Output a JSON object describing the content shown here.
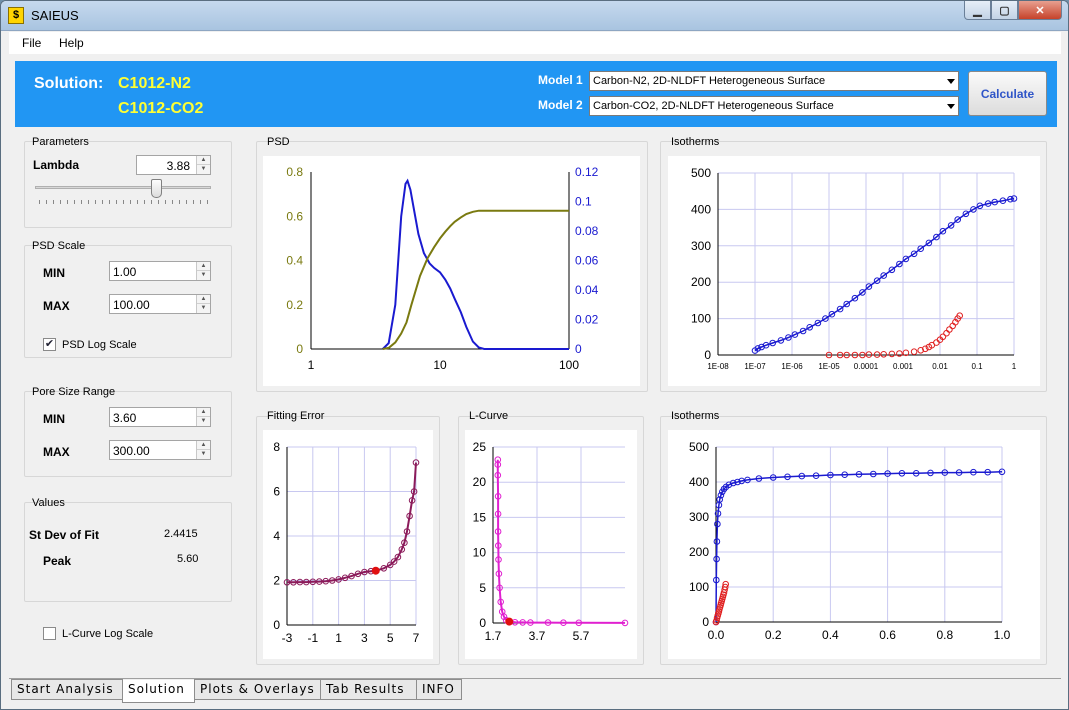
{
  "window": {
    "title": "SAIEUS",
    "icon": "s-logo-icon"
  },
  "menu": [
    "File",
    "Help"
  ],
  "header": {
    "solution_label": "Solution:",
    "solution_names": [
      "C1012-N2",
      "C1012-CO2"
    ],
    "model1_label": "Model 1",
    "model2_label": "Model 2",
    "model1_value": "Carbon-N2, 2D-NLDFT Heterogeneous Surface",
    "model2_value": "Carbon-CO2, 2D-NLDFT Heterogeneous Surface",
    "calculate_label": "Calculate"
  },
  "parameters": {
    "title": "Parameters",
    "lambda_label": "Lambda",
    "lambda_value": "3.88",
    "lambda_slider_fraction": 0.7
  },
  "psd_scale": {
    "title": "PSD Scale",
    "min_label": "MIN",
    "min_value": "1.00",
    "max_label": "MAX",
    "max_value": "100.00",
    "log_label": "PSD Log Scale",
    "log_checked": true
  },
  "pore_range": {
    "title": "Pore Size Range",
    "min_label": "MIN",
    "min_value": "3.60",
    "max_label": "MAX",
    "max_value": "300.00"
  },
  "values": {
    "title": "Values",
    "stdev_label": "St Dev of Fit",
    "stdev_value": "2.4415",
    "peak_label": "Peak",
    "peak_value": "5.60"
  },
  "lcurve_log": {
    "label": "L-Curve Log Scale",
    "checked": false
  },
  "panels": {
    "psd": "PSD",
    "isotherms_top": "Isotherms",
    "fitting_error": "Fitting Error",
    "lcurve": "L-Curve",
    "isotherms_bottom": "Isotherms"
  },
  "tabs": [
    "Start Analysis",
    "Solution",
    "Plots & Overlays",
    "Tab Results",
    "INFO"
  ],
  "active_tab": 1,
  "colors": {
    "header_bg": "#2196f3",
    "solution_name": "#ffff33",
    "n2_series": "#1a1ad0",
    "co2_series": "#e02020",
    "cumulative": "#7a7a10",
    "fitting": "#8b1a5a",
    "lcurve": "#e020d0"
  },
  "chart_data": [
    {
      "id": "psd",
      "type": "line",
      "title": "PSD",
      "x_scale": "log",
      "xlim": [
        1,
        100
      ],
      "x_ticks": [
        "1",
        "10",
        "100"
      ],
      "ylim_left": [
        0,
        0.8
      ],
      "y_ticks_left": [
        "0",
        "0.2",
        "0.4",
        "0.6",
        "0.8"
      ],
      "ylim_right": [
        0,
        0.12
      ],
      "y_ticks_right": [
        "0",
        "0.02",
        "0.04",
        "0.06",
        "0.08",
        "0.1",
        "0.12"
      ],
      "series": [
        {
          "axis": "right",
          "color": "#1a1ad0",
          "x": [
            3.6,
            4.0,
            4.5,
            5.0,
            5.4,
            5.6,
            5.9,
            6.3,
            6.8,
            7.5,
            8.3,
            9.0,
            10.0,
            11.0,
            12.0,
            13.0,
            14.5,
            16.0,
            18.0,
            20.0,
            22.0,
            30,
            50,
            100
          ],
          "y": [
            0,
            0.004,
            0.03,
            0.09,
            0.112,
            0.114,
            0.108,
            0.094,
            0.078,
            0.065,
            0.058,
            0.055,
            0.052,
            0.047,
            0.041,
            0.034,
            0.025,
            0.015,
            0.005,
            0.001,
            0,
            0,
            0,
            0
          ]
        },
        {
          "axis": "left",
          "color": "#7a7a10",
          "x": [
            3.6,
            4.0,
            4.5,
            5.0,
            5.5,
            6.0,
            7.0,
            8.0,
            9.0,
            10.0,
            11.0,
            12.0,
            13.0,
            14.5,
            16.0,
            18.0,
            20.0,
            22.0,
            30,
            50,
            100
          ],
          "y": [
            0,
            0.005,
            0.03,
            0.07,
            0.12,
            0.2,
            0.33,
            0.41,
            0.46,
            0.5,
            0.53,
            0.555,
            0.575,
            0.595,
            0.61,
            0.62,
            0.625,
            0.625,
            0.625,
            0.625,
            0.625
          ]
        }
      ]
    },
    {
      "id": "isotherms_log",
      "type": "scatter",
      "title": "Isotherms",
      "x_scale": "log",
      "xlim": [
        1e-08,
        1
      ],
      "x_ticks": [
        "1E-08",
        "1E-07",
        "1E-06",
        "1E-05",
        "0.0001",
        "0.001",
        "0.01",
        "0.1",
        "1"
      ],
      "ylim": [
        0,
        500
      ],
      "y_ticks": [
        "0",
        "100",
        "200",
        "300",
        "400",
        "500"
      ],
      "series": [
        {
          "color": "#1a1ad0",
          "fit": true,
          "x": [
            1e-07,
            1.2e-07,
            1.5e-07,
            2e-07,
            3e-07,
            5e-07,
            8e-07,
            1.2e-06,
            2e-06,
            3e-06,
            5e-06,
            8e-06,
            1.2e-05,
            2e-05,
            3e-05,
            5e-05,
            8e-05,
            0.00012,
            0.0002,
            0.0003,
            0.0005,
            0.0008,
            0.0012,
            0.002,
            0.003,
            0.005,
            0.008,
            0.012,
            0.02,
            0.03,
            0.05,
            0.08,
            0.12,
            0.2,
            0.3,
            0.5,
            0.8,
            1.0
          ],
          "y": [
            12,
            18,
            22,
            27,
            33,
            40,
            48,
            56,
            66,
            76,
            88,
            100,
            112,
            126,
            140,
            156,
            172,
            188,
            204,
            218,
            234,
            250,
            264,
            278,
            292,
            308,
            324,
            340,
            356,
            372,
            388,
            400,
            410,
            416,
            420,
            424,
            428,
            430
          ]
        },
        {
          "color": "#e02020",
          "fit": false,
          "x": [
            1e-05,
            2e-05,
            3e-05,
            5e-05,
            8e-05,
            0.00012,
            0.0002,
            0.0003,
            0.0005,
            0.0008,
            0.0012,
            0.002,
            0.003,
            0.004,
            0.005,
            0.006,
            0.008,
            0.01,
            0.012,
            0.015,
            0.018,
            0.022,
            0.026,
            0.03,
            0.034
          ],
          "y": [
            0,
            0,
            0,
            0,
            0,
            1,
            1,
            2,
            3,
            4,
            6,
            9,
            13,
            17,
            22,
            27,
            34,
            42,
            50,
            60,
            70,
            80,
            90,
            100,
            108
          ]
        }
      ]
    },
    {
      "id": "fitting_error",
      "type": "line",
      "title": "Fitting Error",
      "xlim": [
        -3,
        7
      ],
      "x_ticks": [
        "-3",
        "-1",
        "1",
        "3",
        "5",
        "7"
      ],
      "ylim": [
        0,
        8
      ],
      "y_ticks": [
        "0",
        "2",
        "4",
        "6",
        "8"
      ],
      "selected_x": 3.88,
      "series": [
        {
          "color": "#8b1a5a",
          "x": [
            -3,
            -2.5,
            -2,
            -1.5,
            -1,
            -0.5,
            0,
            0.5,
            1,
            1.5,
            2,
            2.5,
            3,
            3.5,
            3.88,
            4.5,
            5,
            5.3,
            5.6,
            5.9,
            6.1,
            6.3,
            6.5,
            6.7,
            6.85,
            7
          ],
          "y": [
            1.92,
            1.92,
            1.93,
            1.93,
            1.94,
            1.95,
            1.97,
            2.0,
            2.05,
            2.12,
            2.2,
            2.3,
            2.38,
            2.42,
            2.44,
            2.55,
            2.7,
            2.85,
            3.05,
            3.4,
            3.7,
            4.2,
            4.9,
            5.6,
            6.0,
            7.3
          ]
        }
      ]
    },
    {
      "id": "lcurve",
      "type": "line",
      "title": "L-Curve",
      "xlim": [
        1.7,
        7.7
      ],
      "x_ticks": [
        "1.7",
        "3.7",
        "5.7"
      ],
      "ylim": [
        0,
        25
      ],
      "y_ticks": [
        "0",
        "5",
        "10",
        "15",
        "20",
        "25"
      ],
      "selected_x": 2.44,
      "series": [
        {
          "color": "#e020d0",
          "x": [
            1.92,
            1.92,
            1.92,
            1.93,
            1.93,
            1.93,
            1.94,
            1.95,
            1.97,
            2.0,
            2.05,
            2.12,
            2.2,
            2.3,
            2.44,
            2.7,
            3.05,
            3.4,
            4.2,
            4.9,
            5.6,
            7.7
          ],
          "y": [
            23.2,
            22.5,
            21.0,
            18.0,
            15.5,
            13.0,
            11.0,
            9.0,
            7.0,
            5.0,
            3.0,
            1.6,
            0.9,
            0.4,
            0.2,
            0.1,
            0.08,
            0.06,
            0.05,
            0.04,
            0.03,
            0.02
          ]
        }
      ]
    },
    {
      "id": "isotherms_linear",
      "type": "scatter",
      "title": "Isotherms",
      "xlim": [
        0,
        1
      ],
      "x_ticks": [
        "0.0",
        "0.2",
        "0.4",
        "0.6",
        "0.8",
        "1.0"
      ],
      "ylim": [
        0,
        500
      ],
      "y_ticks": [
        "0",
        "100",
        "200",
        "300",
        "400",
        "500"
      ],
      "series": [
        {
          "color": "#1a1ad0",
          "fit": true,
          "x": [
            0,
            0.001,
            0.002,
            0.003,
            0.005,
            0.007,
            0.01,
            0.013,
            0.017,
            0.022,
            0.028,
            0.035,
            0.045,
            0.06,
            0.075,
            0.09,
            0.11,
            0.15,
            0.2,
            0.25,
            0.3,
            0.35,
            0.4,
            0.45,
            0.5,
            0.55,
            0.6,
            0.65,
            0.7,
            0.75,
            0.8,
            0.85,
            0.9,
            0.95,
            1.0
          ],
          "y": [
            0,
            120,
            180,
            230,
            280,
            310,
            334,
            350,
            362,
            372,
            380,
            386,
            392,
            397,
            400,
            403,
            406,
            410,
            413,
            415,
            417,
            418,
            420,
            421,
            422,
            423,
            424,
            425,
            425,
            426,
            427,
            427,
            428,
            428,
            429
          ]
        },
        {
          "color": "#e02020",
          "fit": false,
          "x": [
            0,
            0.002,
            0.004,
            0.006,
            0.008,
            0.01,
            0.012,
            0.014,
            0.016,
            0.018,
            0.02,
            0.022,
            0.024,
            0.026,
            0.028,
            0.03,
            0.032,
            0.034
          ],
          "y": [
            0,
            5,
            12,
            18,
            24,
            30,
            36,
            42,
            48,
            54,
            60,
            66,
            72,
            78,
            84,
            92,
            100,
            108
          ]
        }
      ]
    }
  ]
}
